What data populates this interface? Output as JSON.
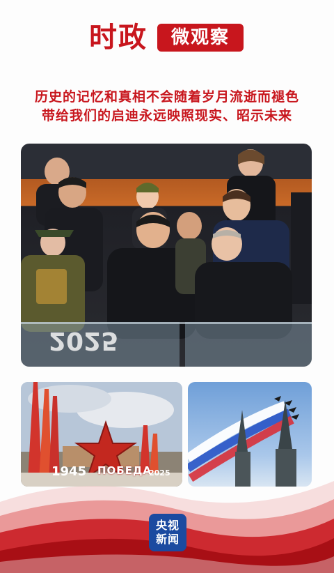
{
  "header": {
    "title_main": "时政",
    "title_tag": "微观察"
  },
  "subtitle": {
    "line1": "历史的记忆和真相不会随着岁月流逝而褪色",
    "line2": "带给我们的启迪永远映照现实、昭示未来"
  },
  "photos": {
    "main": {
      "sign_text": "2025"
    },
    "left": {
      "year_left": "1945",
      "word": "ПОБЕДА",
      "year_right": "2025"
    },
    "right": {}
  },
  "logo": {
    "line1": "央视",
    "line2": "新闻"
  },
  "colors": {
    "accent": "#c8161d",
    "logo_blue": "#1b4aa0"
  }
}
